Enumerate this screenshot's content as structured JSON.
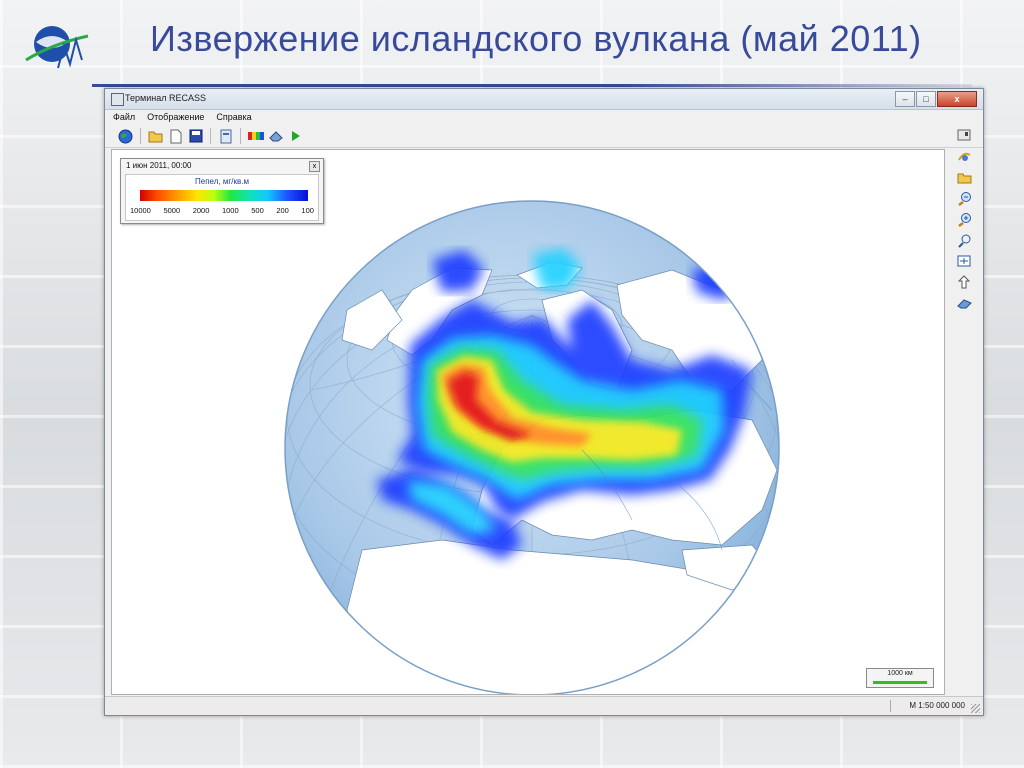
{
  "slide": {
    "title": "Извержение исландского вулкана (май 2011)"
  },
  "window": {
    "title": "Терминал RECASS",
    "controls": [
      "–",
      "□",
      "x"
    ]
  },
  "menu": [
    "Файл",
    "Отображение",
    "Справка"
  ],
  "toolbar_icons": [
    "globe-icon",
    "open-folder-icon",
    "new-document-icon",
    "save-disk-icon",
    "layers-icon",
    "palette-icon",
    "eraser-icon",
    "play-icon"
  ],
  "right_toolbar_icons": [
    "page-settings-icon",
    "rotate-globe-icon",
    "open-folder-icon",
    "zoom-out-icon",
    "zoom-in-icon",
    "pan-zoom-icon",
    "fit-extent-icon",
    "arrow-up-icon",
    "eraser-icon"
  ],
  "legend": {
    "time": "1 июн 2011, 00:00",
    "close": "x",
    "title": "Пепел, мг/кв.м",
    "labels": [
      "10000",
      "5000",
      "2000",
      "1000",
      "500",
      "200",
      "100"
    ]
  },
  "scale_bar": {
    "label": "1000 км"
  },
  "status": {
    "scale": "М 1:50 000 000"
  },
  "colors": {
    "title": "#3a4a9a",
    "ocean": "#a8c8e8",
    "land": "#ffffff",
    "ash_high": "#d40000",
    "ash_low": "#2050ff"
  }
}
